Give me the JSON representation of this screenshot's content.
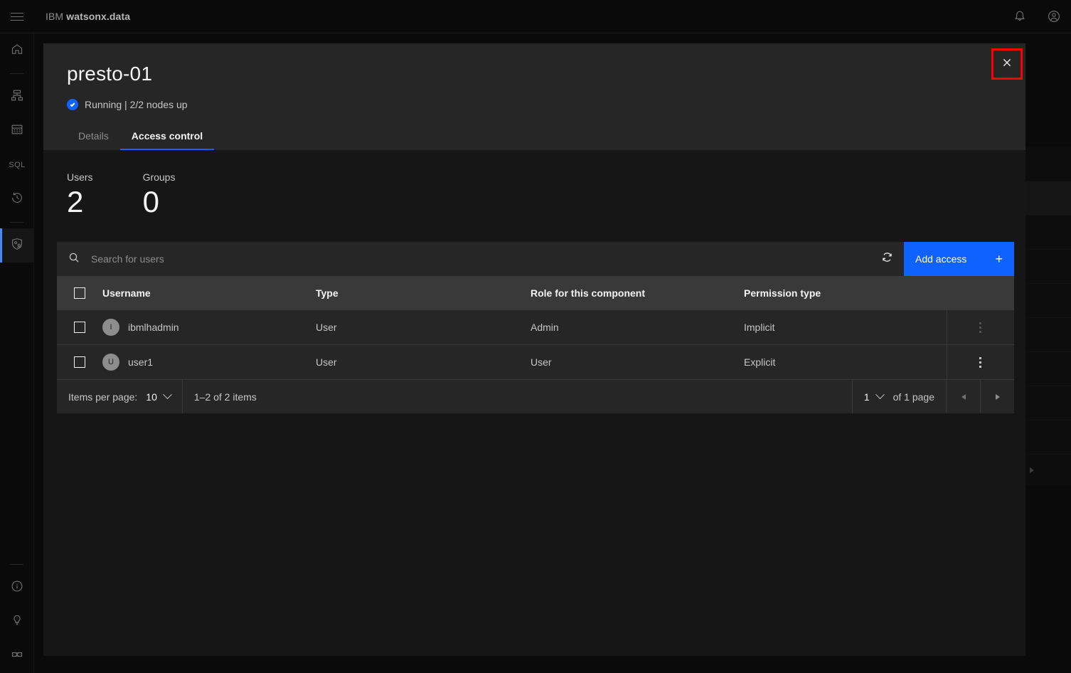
{
  "topbar": {
    "menu_icon": "hamburger-icon",
    "brand_prefix": "IBM",
    "brand_name": "watsonx.data",
    "notifications_icon": "bell-icon",
    "account_icon": "user-avatar-icon"
  },
  "sidebar": {
    "items": [
      {
        "icon": "home-icon",
        "name": "home"
      },
      {
        "icon": "infrastructure-icon",
        "name": "infrastructure-manager"
      },
      {
        "icon": "data-manager-icon",
        "name": "data-manager"
      },
      {
        "icon": "sql-icon",
        "name": "sql",
        "label": "SQL"
      },
      {
        "icon": "history-icon",
        "name": "query-history"
      },
      {
        "icon": "access-control-icon",
        "name": "access-control",
        "active": true
      }
    ],
    "bottom_items": [
      {
        "icon": "info-icon",
        "name": "about"
      },
      {
        "icon": "lightbulb-icon",
        "name": "tips"
      },
      {
        "icon": "support-icon",
        "name": "support"
      }
    ]
  },
  "panel": {
    "title": "presto-01",
    "status_icon": "checkmark-filled-icon",
    "status_text": "Running | 2/2 nodes up",
    "close_icon": "close-icon",
    "tabs": [
      {
        "label": "Details",
        "active": false
      },
      {
        "label": "Access control",
        "active": true
      }
    ]
  },
  "summary": [
    {
      "label": "Users",
      "value": "2"
    },
    {
      "label": "Groups",
      "value": "0"
    }
  ],
  "toolbar": {
    "search_icon": "search-icon",
    "search_placeholder": "Search for users",
    "search_value": "",
    "refresh_icon": "refresh-icon",
    "add_access_label": "Add access",
    "add_access_icon": "plus-icon",
    "add_access_color": "#0f62fe"
  },
  "table": {
    "columns": [
      "Username",
      "Type",
      "Role for this component",
      "Permission type"
    ],
    "rows": [
      {
        "avatar": "I",
        "username": "ibmlhadmin",
        "type": "User",
        "role": "Admin",
        "permission": "Implicit",
        "overflow_icon": "overflow-menu-icon",
        "overflow_dim": true
      },
      {
        "avatar": "U",
        "username": "user1",
        "type": "User",
        "role": "User",
        "permission": "Explicit",
        "overflow_icon": "overflow-menu-icon",
        "overflow_dim": false
      }
    ]
  },
  "pagination": {
    "items_per_page_label": "Items per page:",
    "items_per_page_value": "10",
    "range_text": "1–2 of 2 items",
    "page_value": "1",
    "page_total_text": "of 1 page",
    "prev_icon": "caret-left-icon",
    "next_icon": "caret-right-icon"
  },
  "annotation": {
    "highlight_color": "#ff0000",
    "target": "close-button"
  }
}
